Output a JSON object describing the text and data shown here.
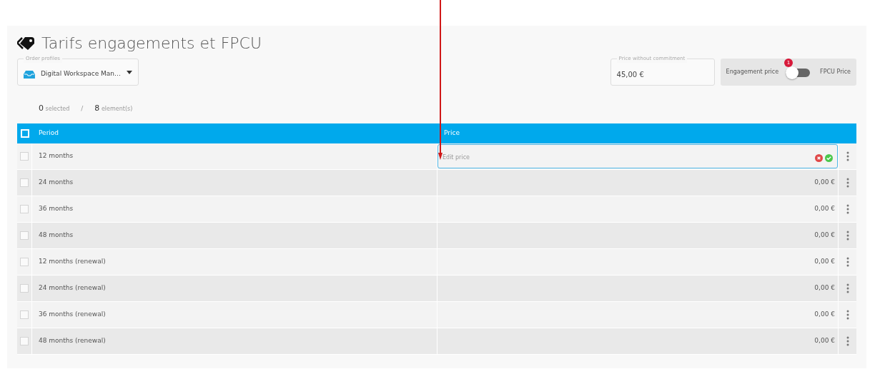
{
  "title": "Tarifs engagements et FPCU",
  "order_profile": {
    "label": "Order profiles",
    "value": "Digital Workspace Man…"
  },
  "price_without_commitment": {
    "label": "Price without commitment",
    "value": "45,00 €"
  },
  "mode_toggle": {
    "left_label": "Engagement price",
    "right_label": "FPCU Price",
    "on": false,
    "badge": "1"
  },
  "summary": {
    "selected_count": "0",
    "selected_label": "selected",
    "separator": "/",
    "total_count": "8",
    "total_label": "element(s)"
  },
  "table": {
    "header_checked": false,
    "columns": [
      "Period",
      "Price"
    ],
    "rows": [
      {
        "kind": "editing",
        "period": "12 months",
        "placeholder": "Edit price",
        "checked": false
      },
      {
        "kind": "value",
        "period": "24 months",
        "price": "0,00 €",
        "checked": false
      },
      {
        "kind": "value",
        "period": "36 months",
        "price": "0,00 €",
        "checked": false
      },
      {
        "kind": "value",
        "period": "48 months",
        "price": "0,00 €",
        "checked": false
      },
      {
        "kind": "value",
        "period": "12 months (renewal)",
        "price": "0,00 €",
        "checked": false
      },
      {
        "kind": "value",
        "period": "24 months (renewal)",
        "price": "0,00 €",
        "checked": false
      },
      {
        "kind": "value",
        "period": "36 months (renewal)",
        "price": "0,00 €",
        "checked": false
      },
      {
        "kind": "value",
        "period": "48 months (renewal)",
        "price": "0,00 €",
        "checked": false
      }
    ]
  }
}
